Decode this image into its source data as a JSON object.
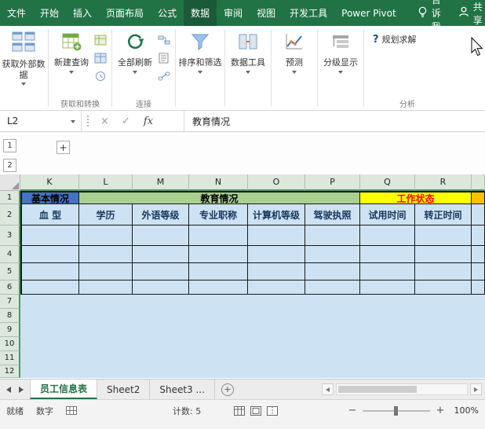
{
  "titlebar": {
    "tabs": [
      "文件",
      "开始",
      "插入",
      "页面布局",
      "公式",
      "数据",
      "审阅",
      "视图",
      "开发工具",
      "Power Pivot"
    ],
    "active_tab": "数据",
    "tell_me": "告诉我",
    "share": "共享"
  },
  "ribbon": {
    "get_external": "获取外部数据",
    "new_query": "新建查询",
    "refresh_all": "全部刷新",
    "sort_filter": "排序和筛选",
    "data_tools": "数据工具",
    "forecast": "预测",
    "outline": "分级显示",
    "solver": "规划求解",
    "groups": {
      "get_transform": "获取和转换",
      "connections": "连接",
      "analysis": "分析"
    }
  },
  "formula_bar": {
    "name_box": "L2",
    "fx": "fx",
    "content": "教育情况"
  },
  "outline_pane": {
    "level1": "1",
    "level2": "2",
    "collapse": "+"
  },
  "grid": {
    "column_headers": [
      "K",
      "L",
      "M",
      "N",
      "O",
      "P",
      "Q",
      "R"
    ],
    "row_headers": [
      "1",
      "2",
      "3",
      "4",
      "5",
      "6",
      "7",
      "8",
      "9",
      "10",
      "11",
      "12"
    ],
    "row1": {
      "basic_info": "基本情况",
      "education": "教育情况",
      "work_status": "工作状态"
    },
    "row2": [
      "血 型",
      "学历",
      "外语等级",
      "专业职称",
      "计算机等级",
      "驾驶执照",
      "试用时间",
      "转正时间"
    ]
  },
  "sheet_tabs": {
    "tabs": [
      "员工信息表",
      "Sheet2",
      "Sheet3 ..."
    ],
    "active": "员工信息表"
  },
  "status_bar": {
    "ready": "就绪",
    "input_mode": "数字",
    "count": "计数: 5",
    "zoom": "100%"
  },
  "icons": {
    "cancel": "×",
    "enter": "✓",
    "new_sheet": "+",
    "zoom_out": "−",
    "zoom_in": "+",
    "solver": "?"
  },
  "colors": {
    "excel_green": "#217346",
    "tab_active_bg": "#1A5A38",
    "basic_info_bg": "#4472C4",
    "education_bg": "#A9D08E",
    "work_status_bg": "#FFFF00",
    "work_status_text": "#FF0000",
    "note_bg": "#FFC000",
    "selection_bg": "#CDE3F3"
  }
}
